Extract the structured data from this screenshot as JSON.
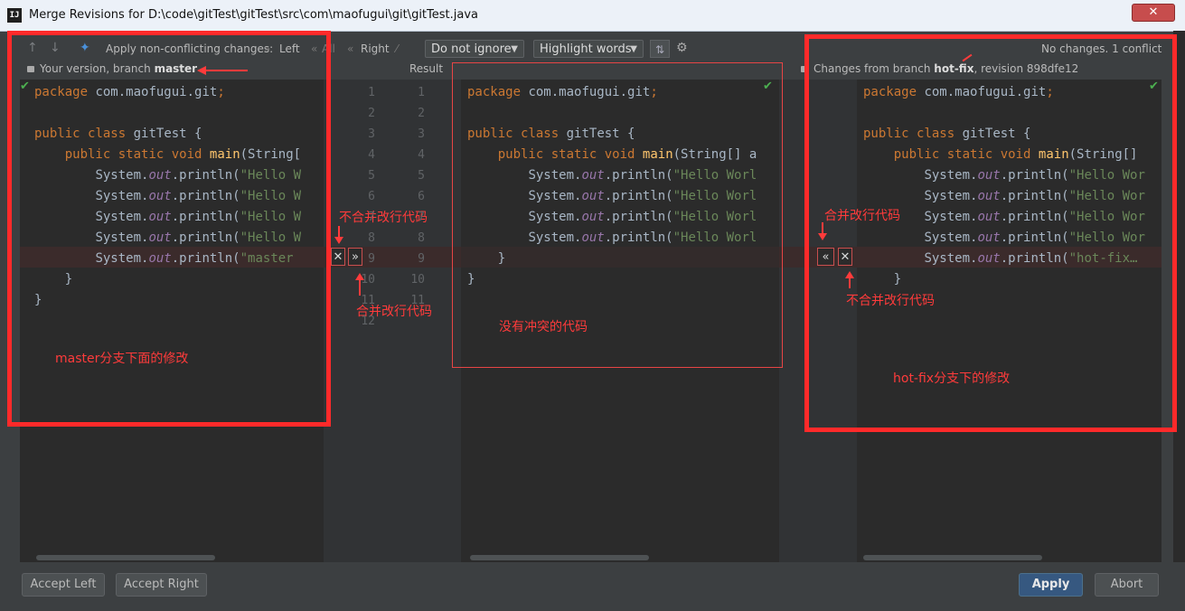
{
  "window": {
    "title": "Merge Revisions for D:\\code\\gitTest\\gitTest\\src\\com\\maofugui\\git\\gitTest.java",
    "app_icon": "IJ",
    "close": "✕"
  },
  "toolbar": {
    "apply_label": "Apply non-conflicting changes:",
    "left": "Left",
    "all": "All",
    "right": "Right",
    "ignore_dropdown": "Do not ignore",
    "highlight_dropdown": "Highlight words",
    "status": "No changes. 1 conflict"
  },
  "headers": {
    "left_prefix": "Your version, branch",
    "left_branch": "master",
    "result": "Result",
    "right_prefix": "Changes from branch",
    "right_branch": "hot-fix",
    "right_suffix": ", revision 898dfe12"
  },
  "code": {
    "line1_pkg": "package",
    "line1_rest": " com.maofugui.git",
    "line1_semi": ";",
    "public": "public",
    "class": "class",
    "classname": " gitTest {",
    "static": "static",
    "void": "void",
    "main": "main",
    "left_args": "(String[",
    "mid_args": "(String[] a",
    "right_args": "(String[] ",
    "system": "System.",
    "out": "out",
    "println": ".println(",
    "hello_left": "\"Hello W",
    "hello_mid": "\"Hello Worl",
    "hello_right": "\"Hello Wor",
    "left_conflict": "\"master",
    "right_conflict": "\"hot-fix…",
    "close_inner": "}",
    "close_outer": "}"
  },
  "line_numbers": [
    "1",
    "2",
    "3",
    "4",
    "5",
    "6",
    "7",
    "8",
    "9",
    "10",
    "11",
    "12"
  ],
  "buttons": {
    "accept_left": "Accept Left",
    "accept_right": "Accept Right",
    "apply": "Apply",
    "abort": "Abort"
  },
  "annotations": {
    "left_reject": "不合并改行代码",
    "left_merge": "合并改行代码",
    "middle": "没有冲突的代码",
    "master_label": "master分支下面的修改",
    "right_merge": "合并改行代码",
    "right_reject": "不合并改行代码",
    "hotfix_label": "hot-fix分支下的修改"
  },
  "colors": {
    "accent": "#ff2a2a",
    "background": "#2b2b2b",
    "primary_button": "#365880"
  }
}
